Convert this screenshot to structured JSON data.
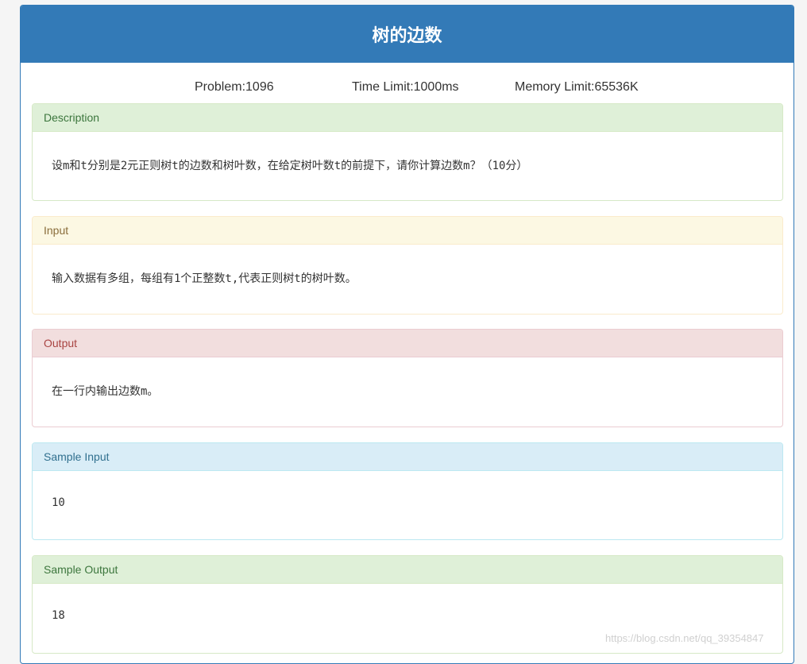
{
  "problem": {
    "title": "树的边数",
    "problem_id": "Problem:1096",
    "time_limit": "Time Limit:1000ms",
    "memory_limit": "Memory Limit:65536K"
  },
  "sections": {
    "description": {
      "heading": "Description",
      "body": "设m和t分别是2元正则树t的边数和树叶数，在给定树叶数t的前提下，请你计算边数m？（10分）"
    },
    "input": {
      "heading": "Input",
      "body": "输入数据有多组，每组有1个正整数t,代表正则树t的树叶数。"
    },
    "output": {
      "heading": "Output",
      "body": "在一行内输出边数m。"
    },
    "sample_input": {
      "heading": "Sample Input",
      "body": "10"
    },
    "sample_output": {
      "heading": "Sample Output",
      "body": "18"
    }
  },
  "watermark": "https://blog.csdn.net/qq_39354847",
  "colors": {
    "title_bar": "#337ab7",
    "success_heading": "#dff0d8",
    "warning_heading": "#fcf8e3",
    "danger_heading": "#f2dede",
    "info_heading": "#d9edf7"
  }
}
